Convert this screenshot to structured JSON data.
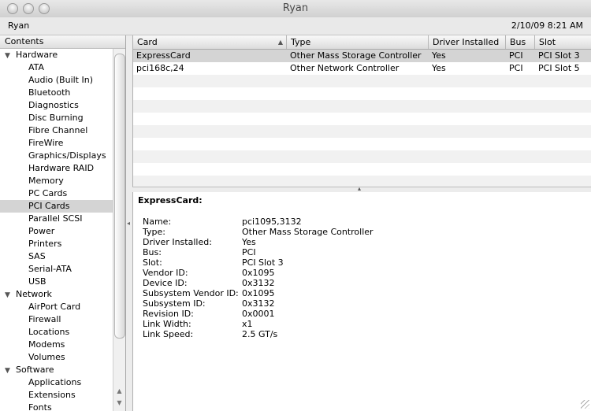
{
  "window": {
    "title": "Ryan"
  },
  "info": {
    "computer_name": "Ryan",
    "datetime": "2/10/09 8:21 AM"
  },
  "sidebar": {
    "header": "Contents",
    "groups": [
      {
        "label": "Hardware",
        "items": [
          "ATA",
          "Audio (Built In)",
          "Bluetooth",
          "Diagnostics",
          "Disc Burning",
          "Fibre Channel",
          "FireWire",
          "Graphics/Displays",
          "Hardware RAID",
          "Memory",
          "PC Cards",
          "PCI Cards",
          "Parallel SCSI",
          "Power",
          "Printers",
          "SAS",
          "Serial-ATA",
          "USB"
        ]
      },
      {
        "label": "Network",
        "items": [
          "AirPort Card",
          "Firewall",
          "Locations",
          "Modems",
          "Volumes"
        ]
      },
      {
        "label": "Software",
        "items": [
          "Applications",
          "Extensions",
          "Fonts"
        ]
      }
    ],
    "selected": "PCI Cards"
  },
  "table": {
    "columns": [
      "Card",
      "Type",
      "Driver Installed",
      "Bus",
      "Slot"
    ],
    "rows": [
      [
        "ExpressCard",
        "Other Mass Storage Controller",
        "Yes",
        "PCI",
        "PCI Slot 3"
      ],
      [
        "pci168c,24",
        "Other Network Controller",
        "Yes",
        "PCI",
        "PCI Slot 5"
      ]
    ]
  },
  "detail": {
    "title": "ExpressCard:",
    "fields": [
      [
        "Name:",
        "pci1095,3132"
      ],
      [
        "Type:",
        "Other Mass Storage Controller"
      ],
      [
        "Driver Installed:",
        "Yes"
      ],
      [
        "Bus:",
        "PCI"
      ],
      [
        "Slot:",
        "PCI Slot 3"
      ],
      [
        "Vendor ID:",
        "0x1095"
      ],
      [
        "Device ID:",
        "0x3132"
      ],
      [
        "Subsystem Vendor ID:",
        "0x1095"
      ],
      [
        "Subsystem ID:",
        "0x3132"
      ],
      [
        "Revision ID:",
        "0x0001"
      ],
      [
        "Link Width:",
        "x1"
      ],
      [
        "Link Speed:",
        "2.5 GT/s"
      ]
    ]
  }
}
